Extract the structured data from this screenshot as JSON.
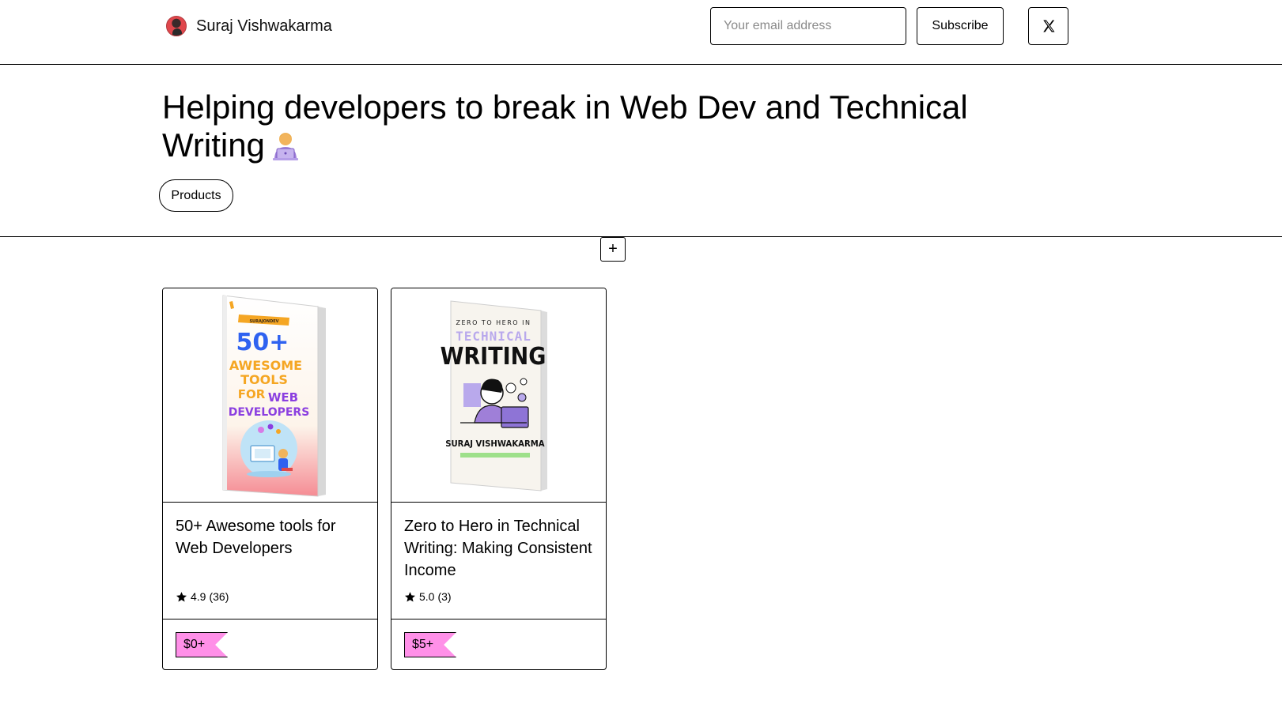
{
  "header": {
    "author_name": "Suraj Vishwakarma",
    "email_placeholder": "Your email address",
    "subscribe_label": "Subscribe",
    "social_icon": "x-logo-icon"
  },
  "hero": {
    "title": "Helping developers to break in Web Dev and Technical Writing",
    "title_emoji": "person-technologist-emoji",
    "products_tab": "Products"
  },
  "add_button_label": "+",
  "products": [
    {
      "title": "50+ Awesome tools for Web Developers",
      "rating": "4.9",
      "rating_count": "(36)",
      "price": "$0+",
      "cover": {
        "brand": "SURAJONDEV",
        "headline": "50+",
        "line1": "AWESOME",
        "line2": "TOOLS",
        "line3_a": "FOR",
        "line3_b": "WEB",
        "line4": "DEVELOPERS"
      }
    },
    {
      "title": "Zero to Hero in Technical Writing: Making Consistent Income",
      "rating": "5.0",
      "rating_count": "(3)",
      "price": "$5+",
      "cover": {
        "top": "ZERO TO HERO IN",
        "line1": "TECHNICAL",
        "line2": "WRITING",
        "author": "SURAJ VISHWAKARMA"
      }
    }
  ],
  "colors": {
    "price_tag": "#ff90e8",
    "border": "#000000"
  }
}
